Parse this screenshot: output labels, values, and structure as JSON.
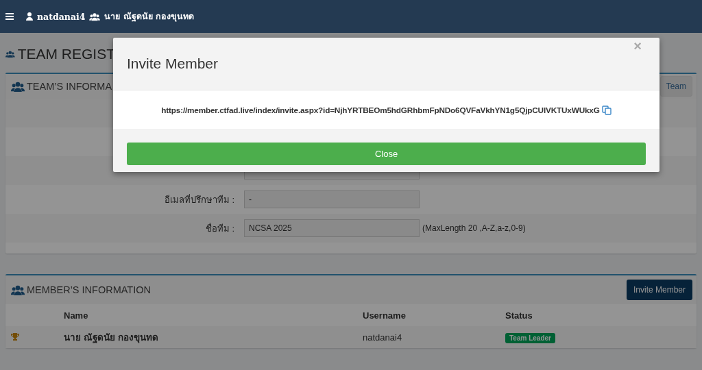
{
  "header": {
    "username": "natdanai4",
    "member_name": "นาย ณัฐดนัย กองขุนทด"
  },
  "page_title": "TEAM REGIST",
  "team_panel": {
    "title": "TEAM’S INFORMA",
    "button": "Team",
    "fields": [
      {
        "kind": "input"
      },
      {
        "kind": "input",
        "label": "อีเมลที่ปรึกษาทีม :",
        "value": "-"
      },
      {
        "kind": "input",
        "label": "ชื่อทีม :",
        "value": "NCSA 2025",
        "hint": "(MaxLength 20 ,A-Z,a-z,0-9)"
      }
    ]
  },
  "members_panel": {
    "title": "MEMBER’S INFORMATION",
    "button": "Invite Member",
    "columns": [
      "Name",
      "Username",
      "Status"
    ],
    "rows": [
      {
        "leader": true,
        "name": "นาย ณัฐดนัย กองขุนทด",
        "username": "natdanai4",
        "status": "Team Leader"
      }
    ]
  },
  "modal": {
    "title": "Invite Member",
    "close_symbol": "×",
    "link": "https://member.ctfad.live/index/invite.aspx?id=NjhYRTBEOm5hdGRhbmFpNDo6QVFaVkhYN1g5QjpCUlVKTUxWUkxG",
    "button": "Close"
  }
}
